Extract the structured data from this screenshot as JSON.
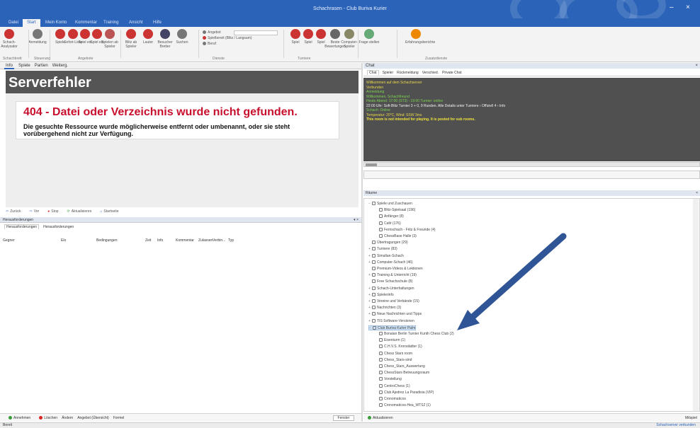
{
  "window": {
    "title": "Schachrasen - Club Buriva Kurier"
  },
  "ribbon_tabs": [
    "Datei",
    "Start",
    "Mein Konto",
    "Kommentar",
    "Training",
    "Ansicht",
    "Hilfe"
  ],
  "ribbon_buttons": [
    "Schach-Analysator",
    "Anmeldung",
    "Spiele",
    "Sofort-Liste",
    "Spiel ein",
    "Spiel ein",
    "Spielen ab Spieler",
    "Blitz ab Spieler",
    "Lauter",
    "Besucher Bretter",
    "Suchen",
    "Spiel",
    "Spiel",
    "Spiel",
    "Beste Bewertungen",
    "Computer-Spieler",
    "Frage stellen",
    "Erfahrungsberichte"
  ],
  "ribbon_small": [
    "Angebot",
    "Spielbereit (Blitz / Langsam)",
    "Beruf"
  ],
  "ribbon_groups": [
    "Schachbrett",
    "Steuerung",
    "Angebote",
    "Dienste",
    "Turniere",
    "Zusatzdienste"
  ],
  "left_tabs": [
    "Info",
    "Spiele",
    "Partien",
    "Weiterg."
  ],
  "browser": {
    "header": "Serverfehler",
    "error_title": "404 - Datei oder Verzeichnis wurde nicht gefunden.",
    "error_text": "Die gesuchte Ressource wurde möglicherweise entfernt oder umbenannt, oder sie steht vorübergehend nicht zur Verfügung."
  },
  "browser_nav": [
    "Zurück",
    "Vor",
    "Stop",
    "Aktualisieren",
    "Startseite"
  ],
  "challenges": {
    "title": "Herausforderungen",
    "tabs": [
      "Herausforderungen",
      "Herausforderungen"
    ],
    "columns": [
      "Gegner",
      "Elo",
      "Bedingungen",
      "Zeit",
      "Info",
      "Kommentar",
      "Zulassen",
      "Verbin...",
      "Typ"
    ]
  },
  "left_bottom_buttons": [
    "Annehmen",
    "Löschen",
    "Ändern",
    "Angebot (Übersicht)",
    "Formel"
  ],
  "fenster_label": "Fenster",
  "chat": {
    "title": "Chat",
    "tabs": [
      "Chat",
      "Spieler",
      "Rückmeldung",
      "Verschied.",
      "Private Chat"
    ],
    "lines": [
      {
        "text": "Willkommen auf dem Schachserver",
        "cls": "cyl"
      },
      {
        "text": "Verbunden",
        "cls": "cyl"
      },
      {
        "text": "Anmeldung",
        "cls": "cgr"
      },
      {
        "text": "Willkommen, Schachfreund",
        "cls": "cgr"
      },
      {
        "text": "Heute Abend: 17:00 (ST3) - 19:00 Turnier: online",
        "cls": "cgr"
      },
      {
        "text": "22:00 Uhr: Sofi-Blitz Turnier 3 + 0, 9 Runden. Alle Details unter Turniere  ›  Offiziell 4  ›  Info",
        "cls": "cwh"
      },
      {
        "text": "Schach: Online",
        "cls": "cgr"
      },
      {
        "text": "Temperatur: 20°C, Wind: SSW 3ms",
        "cls": "cyl"
      },
      {
        "text": "This room is not intended for playing. It is posted for sub rooms.",
        "cls": "cyb"
      }
    ]
  },
  "tree": {
    "title": "Räume",
    "items": [
      {
        "label": "Spiele und Zuschauen",
        "indent": 0,
        "expand": "−"
      },
      {
        "label": "Blitz-Spielsaal (196)",
        "indent": 1,
        "expand": ""
      },
      {
        "label": "Anfänger (8)",
        "indent": 1,
        "expand": ""
      },
      {
        "label": "Café (176)",
        "indent": 1,
        "expand": ""
      },
      {
        "label": "Fernschach - Fritz & Freunde (4)",
        "indent": 1,
        "expand": ""
      },
      {
        "label": "ChessBase Halle (3)",
        "indent": 1,
        "expand": ""
      },
      {
        "label": "Übertragungen (29)",
        "indent": 0,
        "expand": ""
      },
      {
        "label": "Turniere (83)",
        "indent": 0,
        "expand": "+"
      },
      {
        "label": "Simultan-Schach",
        "indent": 0,
        "expand": "+"
      },
      {
        "label": "Computer-Schach (46)",
        "indent": 0,
        "expand": "+"
      },
      {
        "label": "Premium-Videos & Lektionen",
        "indent": 0,
        "expand": ""
      },
      {
        "label": "Training & Unterricht (19)",
        "indent": 0,
        "expand": "+"
      },
      {
        "label": "Free Schachschule (8)",
        "indent": 0,
        "expand": ""
      },
      {
        "label": "Schach-Unterhaltungen",
        "indent": 0,
        "expand": "+"
      },
      {
        "label": "Spielerinfo",
        "indent": 0,
        "expand": "+"
      },
      {
        "label": "Vereine und Verbände (15)",
        "indent": 0,
        "expand": "+"
      },
      {
        "label": "Nachrichten (3)",
        "indent": 0,
        "expand": "+"
      },
      {
        "label": "Neue Nachrichten und Tipps",
        "indent": 0,
        "expand": "+"
      },
      {
        "label": "TIS Software-Versionen",
        "indent": 0,
        "expand": "+"
      },
      {
        "label": "Club Buriva Kurier Palm",
        "indent": 0,
        "expand": "−",
        "selected": true
      },
      {
        "label": "Bonalan Berlin Turnier Kunth Chess Club (2)",
        "indent": 1,
        "expand": ""
      },
      {
        "label": "Eisenturm (1)",
        "indent": 1,
        "expand": ""
      },
      {
        "label": "C.H.V.S. Kronstädter (1)",
        "indent": 1,
        "expand": ""
      },
      {
        "label": "Chess Stars room",
        "indent": 1,
        "expand": ""
      },
      {
        "label": "Chess_Stars-sind",
        "indent": 1,
        "expand": ""
      },
      {
        "label": "Chess_Stars_Auswertung",
        "indent": 1,
        "expand": ""
      },
      {
        "label": "ChessStars Betreuungsraum",
        "indent": 1,
        "expand": ""
      },
      {
        "label": "Vorstellung",
        "indent": 1,
        "expand": ""
      },
      {
        "label": "CentroChess (1)",
        "indent": 1,
        "expand": ""
      },
      {
        "label": "Club Ajedrez La Paradisia (VIP)",
        "indent": 1,
        "expand": ""
      },
      {
        "label": "Cronomaticos",
        "indent": 1,
        "expand": ""
      },
      {
        "label": "Cronomaticos-Hea_WTS2 (1)",
        "indent": 1,
        "expand": ""
      }
    ]
  },
  "right_bottom": {
    "refresh": "Aktualisieren",
    "right": "Mitspiel"
  },
  "status_bar": {
    "left": "Bereit",
    "right": "Schachserver verbunden"
  },
  "colors": {
    "accent": "#2b63b8",
    "arrow": "#2f5597",
    "error": "#c8102e"
  }
}
